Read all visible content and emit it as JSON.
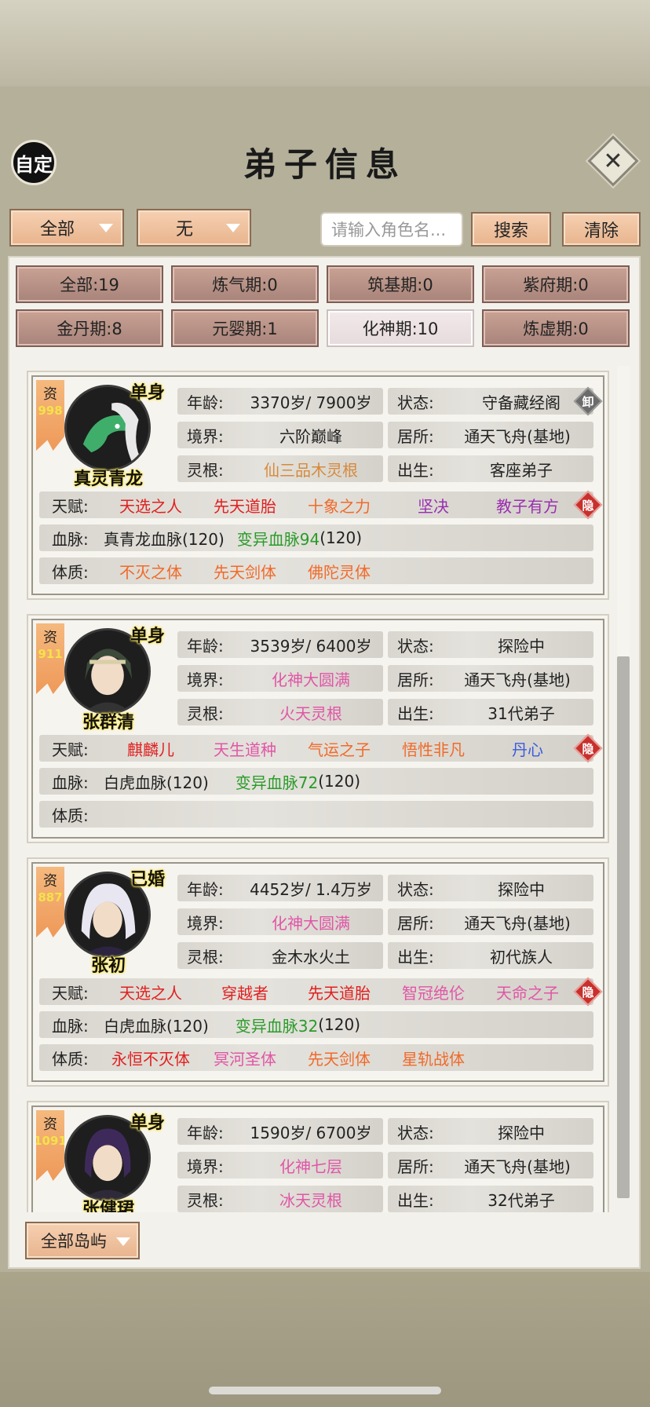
{
  "header": {
    "auto_label": "自定",
    "title": "弟子信息",
    "close_icon": "close-icon"
  },
  "filters": {
    "category": "全部",
    "sub": "无",
    "search_placeholder": "请输入角色名...",
    "search_label": "搜索",
    "clear_label": "清除"
  },
  "stages": [
    "全部:19",
    "炼气期:0",
    "筑基期:0",
    "紫府期:0",
    "金丹期:8",
    "元婴期:1",
    "化神期:10",
    "炼虚期:0"
  ],
  "labels": {
    "age": "年龄:",
    "state": "状态:",
    "realm": "境界:",
    "residence": "居所:",
    "root": "灵根:",
    "birth": "出生:",
    "talent": "天赋:",
    "blood": "血脉:",
    "body": "体质:",
    "aptitude": "资",
    "badge_unload": "卸",
    "badge_hidden": "隐"
  },
  "disciples": [
    {
      "aptitude": "998",
      "status": "单身",
      "name": "真灵青龙",
      "age": "3370岁/ 7900岁",
      "state": "守备藏经阁",
      "realm": "六阶巅峰",
      "residence": "通天飞舟(基地)",
      "root": "仙三品木灵根",
      "birth": "客座弟子",
      "talents": [
        "天选之人",
        "先天道胎",
        "十象之力",
        "坚决",
        "教子有方"
      ],
      "blood_a": "真青龙血脉(120)",
      "blood_b_var": "变异血脉94",
      "blood_b_tail": "(120)",
      "bodies": [
        "不灭之体",
        "先天剑体",
        "佛陀灵体"
      ]
    },
    {
      "aptitude": "911",
      "status": "单身",
      "name": "张群清",
      "age": "3539岁/ 6400岁",
      "state": "探险中",
      "realm": "化神大圆满",
      "residence": "通天飞舟(基地)",
      "root": "火天灵根",
      "birth": "31代弟子",
      "talents": [
        "麒麟儿",
        "天生道种",
        "气运之子",
        "悟性非凡",
        "丹心"
      ],
      "blood_a": "白虎血脉(120)",
      "blood_b_var": "变异血脉72",
      "blood_b_tail": "(120)",
      "bodies": []
    },
    {
      "aptitude": "887",
      "status": "已婚",
      "name": "张初",
      "age": "4452岁/ 1.4万岁",
      "state": "探险中",
      "realm": "化神大圆满",
      "residence": "通天飞舟(基地)",
      "root": "金木水火土",
      "birth": "初代族人",
      "talents": [
        "天选之人",
        "穿越者",
        "先天道胎",
        "智冠绝伦",
        "天命之子"
      ],
      "blood_a": "白虎血脉(120)",
      "blood_b_var": "变异血脉32",
      "blood_b_tail": "(120)",
      "bodies": [
        "永恒不灭体",
        "冥河圣体",
        "先天剑体",
        "星轨战体"
      ]
    },
    {
      "aptitude": "1091",
      "status": "单身",
      "name": "张健珺",
      "age": "1590岁/ 6700岁",
      "state": "探险中",
      "realm": "化神七层",
      "residence": "通天飞舟(基地)",
      "root": "冰天灵根",
      "birth": "32代弟子"
    }
  ],
  "footer": {
    "island": "全部岛屿"
  },
  "colors": {
    "red": "#e02020",
    "orange": "#f06a2a",
    "pink": "#e056a6",
    "purple": "#9a2fb0",
    "blue": "#3b5bdb",
    "green": "#2a9b2a",
    "tan": "#d68a3d"
  }
}
